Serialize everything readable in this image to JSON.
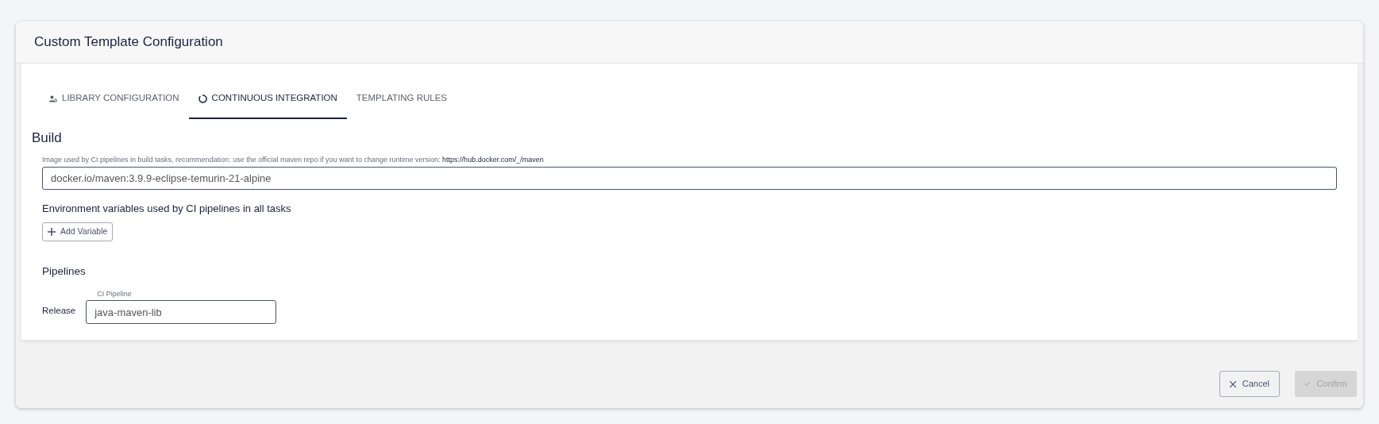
{
  "dialog": {
    "title": "Custom Template Configuration"
  },
  "tabs": [
    {
      "label": "LIBRARY CONFIGURATION",
      "kind": "people",
      "selected": false
    },
    {
      "label": "CONTINUOUS INTEGRATION",
      "kind": "ring",
      "selected": true
    },
    {
      "label": "TEMPLATING RULES",
      "kind": "plain",
      "selected": false
    }
  ],
  "build": {
    "heading": "Build",
    "image_hint": "Image used by CI pipelines in build tasks, recommendation: use the official maven repo if you want to change runtime version: ",
    "image_hint_link": "https://hub.docker.com/_/maven",
    "image_value": "docker.io/maven:3.9.9-eclipse-temurin-21-alpine",
    "env_label": "Environment variables used by CI pipelines in all tasks",
    "add_button": "Add Variable"
  },
  "pipelines": {
    "heading": "Pipelines",
    "rows": [
      {
        "name": "Release",
        "field_label": "CI Pipeline",
        "value": "java-maven-lib"
      }
    ]
  },
  "footer": {
    "buttons": [
      {
        "label": "Cancel",
        "kind": "cancel",
        "disabled": false
      },
      {
        "label": "Confirm",
        "kind": "confirm",
        "disabled": true
      }
    ]
  }
}
